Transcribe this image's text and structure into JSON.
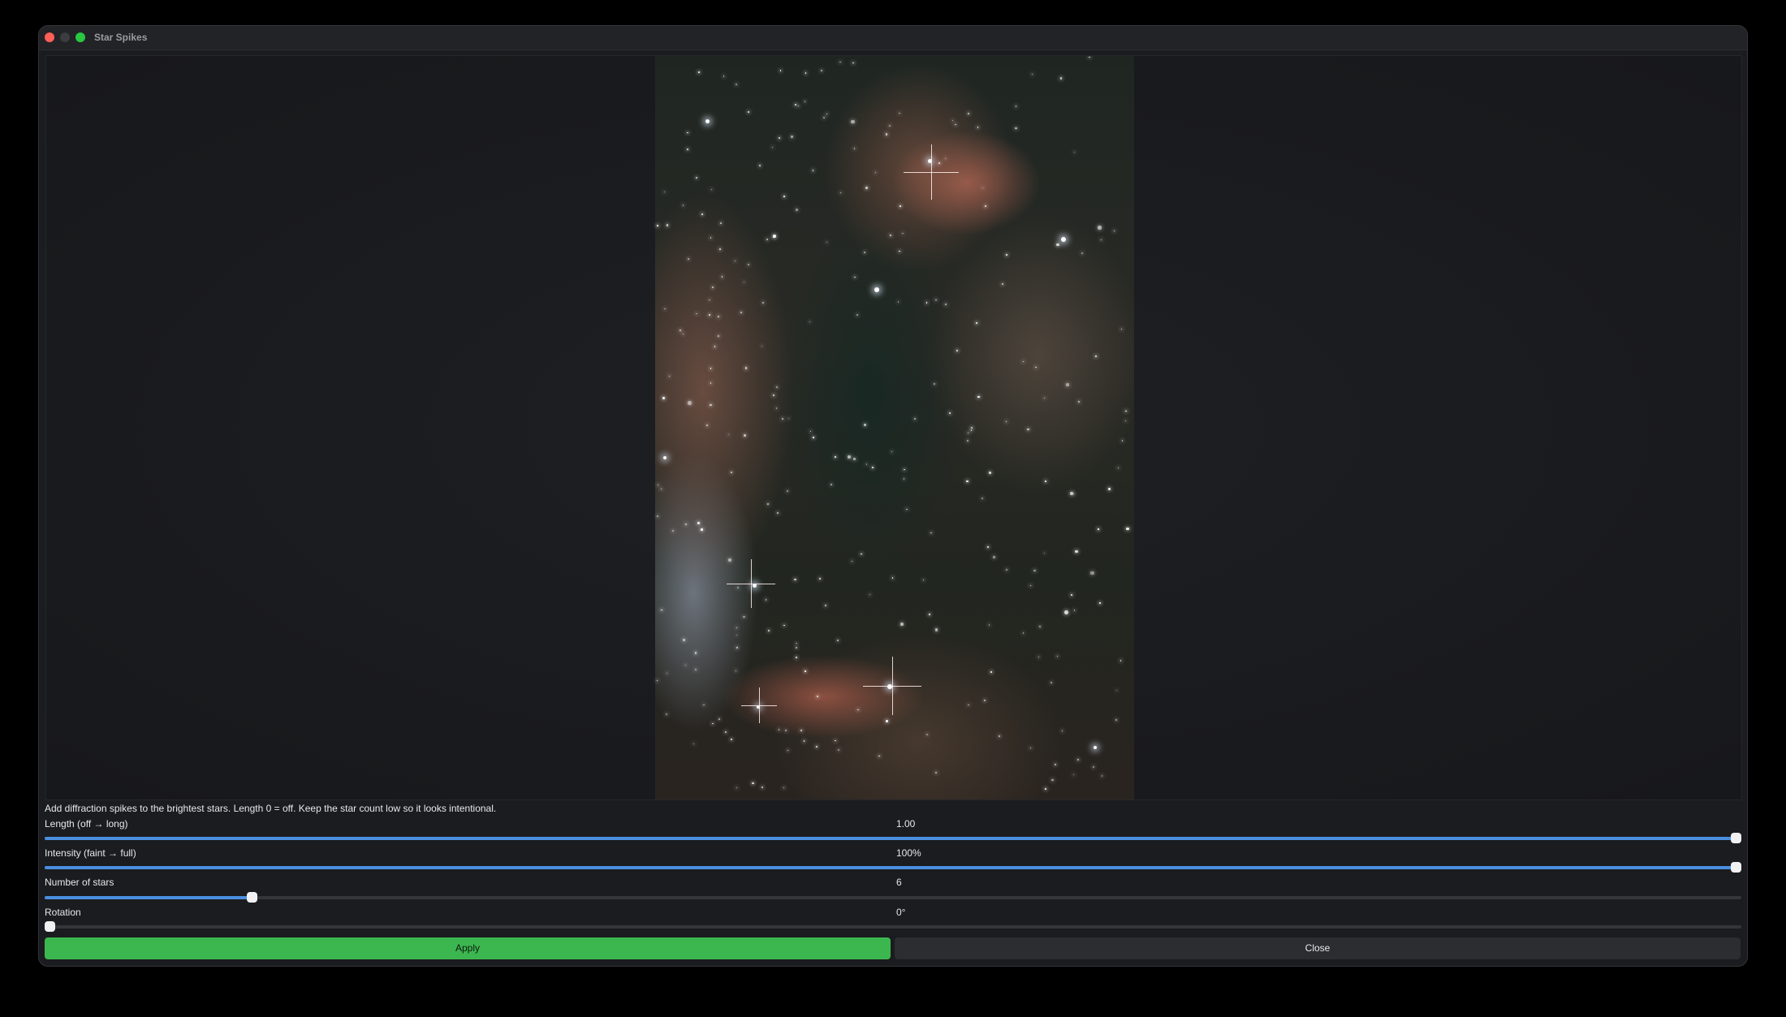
{
  "window": {
    "title": "Star Spikes"
  },
  "viewer": {
    "zoom_out": "–",
    "fit": "⤢",
    "zoom_in": "+"
  },
  "instructions": "Add diffraction spikes to the brightest stars. Length 0 = off. Keep the star count low so it looks intentional.",
  "sliders": [
    {
      "label": "Length (off → long)",
      "value_text": "1.00",
      "fraction": 1.0
    },
    {
      "label": "Intensity (faint → full)",
      "value_text": "100%",
      "fraction": 1.0
    },
    {
      "label": "Number of stars",
      "value_text": "6",
      "fraction": 0.12
    },
    {
      "label": "Rotation",
      "value_text": "0°",
      "fraction": 0.0
    }
  ],
  "buttons": {
    "apply": "Apply",
    "close": "Close"
  },
  "colors": {
    "apply_green": "#3cb750",
    "slider_blue": "#4a8fe0"
  }
}
